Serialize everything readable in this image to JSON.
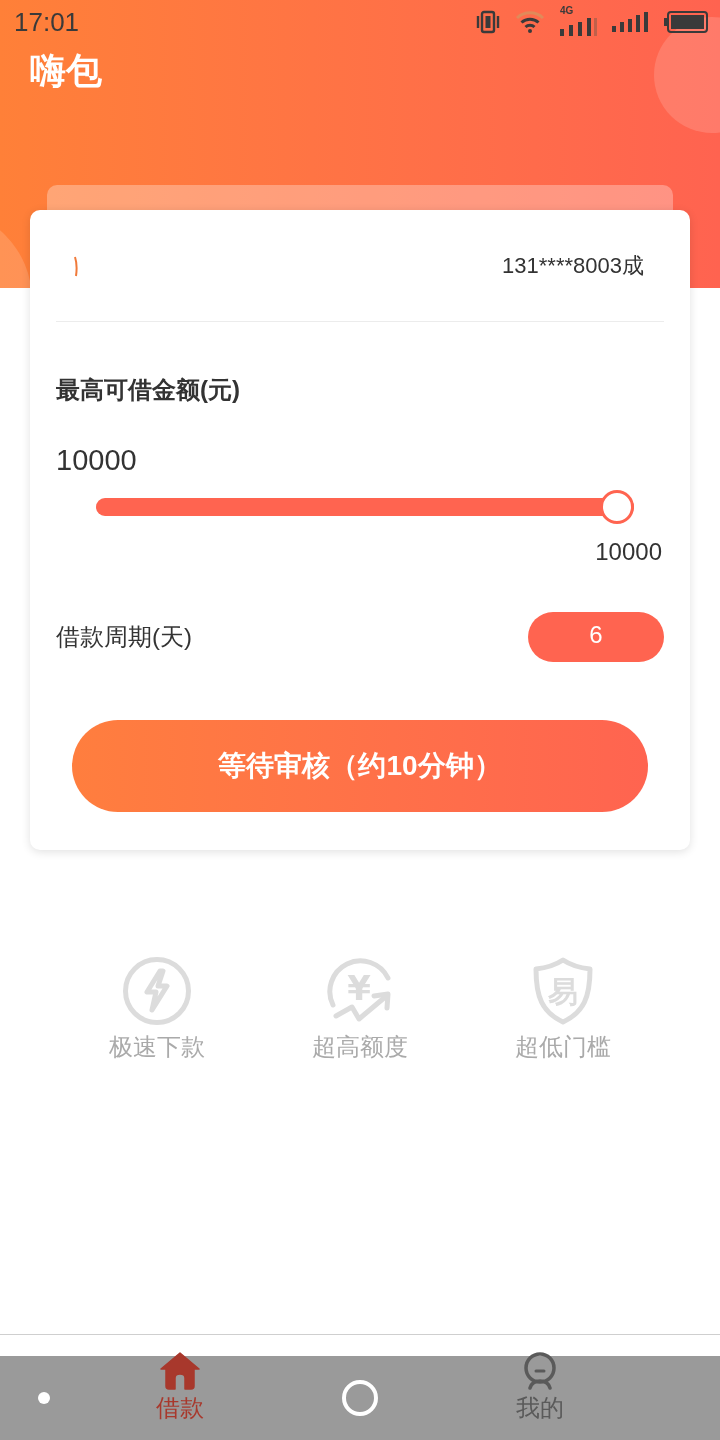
{
  "status_bar": {
    "time": "17:01",
    "network": "4G"
  },
  "header": {
    "title": "嗨包"
  },
  "account": {
    "phone": "131****8003成"
  },
  "loan": {
    "amount_label": "最高可借金额(元)",
    "amount": "10000",
    "slider": {
      "level": 1,
      "max_label": "10000"
    },
    "period_label": "借款周期(天)",
    "period_value": "6"
  },
  "submit_button": {
    "label": "等待审核（约10分钟）"
  },
  "features": [
    {
      "kind": "lightning",
      "label": "极速下款"
    },
    {
      "kind": "yuan",
      "glyph": "¥",
      "label": "超高额度"
    },
    {
      "kind": "shield",
      "glyph": "易",
      "label": "超低门槛"
    }
  ],
  "tab_bar": [
    {
      "kind": "home",
      "label": "借款",
      "selected": true
    },
    {
      "kind": "person",
      "label": "我的",
      "selected": false
    }
  ]
}
